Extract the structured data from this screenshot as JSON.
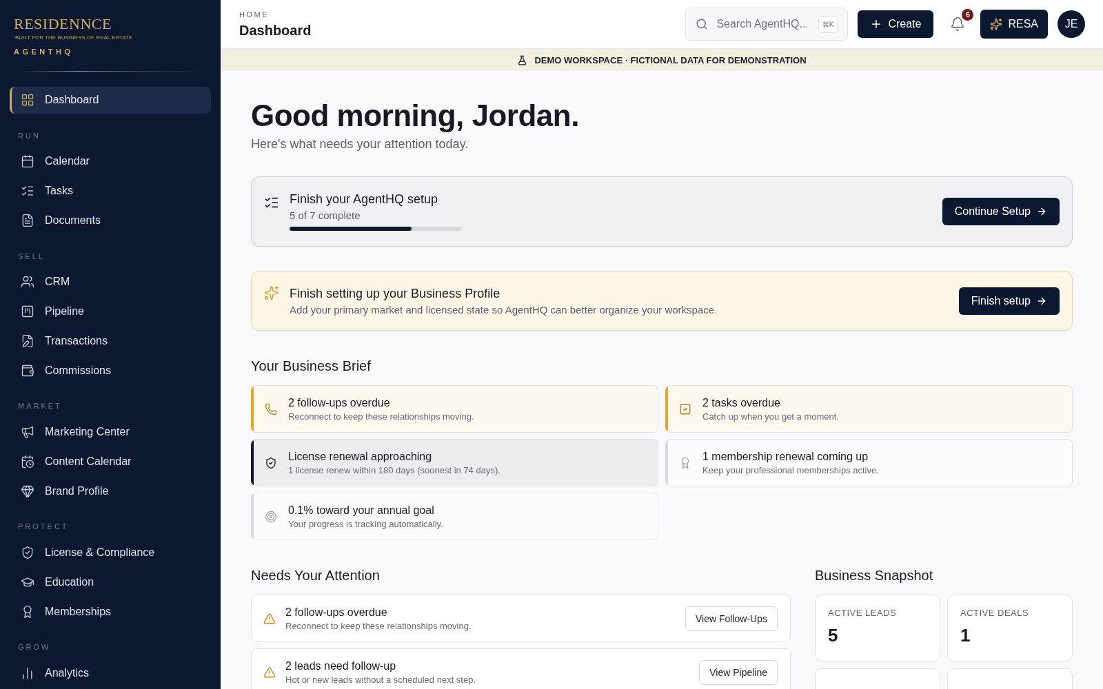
{
  "sidebar": {
    "logo": {
      "name": "RESIDENNCE",
      "tagline": "BUILT FOR THE BUSINESS OF REAL ESTATE",
      "product": "AGENTHQ"
    },
    "sections": [
      {
        "items": [
          {
            "label": "Dashboard",
            "kind": "grid",
            "selected": true
          }
        ]
      },
      {
        "title": "RUN",
        "items": [
          {
            "label": "Calendar",
            "kind": "calendar",
            "selected": false
          },
          {
            "label": "Tasks",
            "kind": "tasks",
            "selected": false
          },
          {
            "label": "Documents",
            "kind": "document",
            "selected": false
          }
        ]
      },
      {
        "title": "SELL",
        "items": [
          {
            "label": "CRM",
            "kind": "users",
            "selected": false
          },
          {
            "label": "Pipeline",
            "kind": "kanban",
            "selected": false
          },
          {
            "label": "Transactions",
            "kind": "file-pen",
            "selected": false
          },
          {
            "label": "Commissions",
            "kind": "wallet",
            "selected": false
          }
        ]
      },
      {
        "title": "MARKET",
        "items": [
          {
            "label": "Marketing Center",
            "kind": "megaphone",
            "selected": false
          },
          {
            "label": "Content Calendar",
            "kind": "calendar-clock",
            "selected": false
          },
          {
            "label": "Brand Profile",
            "kind": "gem",
            "selected": false
          }
        ]
      },
      {
        "title": "PROTECT",
        "items": [
          {
            "label": "License & Compliance",
            "kind": "shield",
            "selected": false
          },
          {
            "label": "Education",
            "kind": "cap",
            "selected": false
          },
          {
            "label": "Memberships",
            "kind": "award",
            "selected": false
          }
        ]
      },
      {
        "title": "GROW",
        "items": [
          {
            "label": "Analytics",
            "kind": "chart",
            "selected": false
          }
        ]
      }
    ]
  },
  "header": {
    "breadcrumb": "HOME",
    "title": "Dashboard",
    "search": {
      "placeholder": "Search AgentHQ...",
      "shortcut": "⌘K"
    },
    "create_button": "Create",
    "notifications": "6",
    "assistant_button": "RESA",
    "avatar": "JE"
  },
  "demo_banner": "DEMO WORKSPACE · FICTIONAL DATA FOR DEMONSTRATION",
  "greeting": {
    "title": "Good morning, Jordan.",
    "subtitle": "Here's what needs your attention today."
  },
  "setup_card": {
    "title": "Finish your AgentHQ setup",
    "progress_text": "5 of 7 complete",
    "level": 0.71,
    "button": "Continue Setup"
  },
  "profile_card": {
    "title": "Finish setting up your Business Profile",
    "text": "Add your primary market and licensed state so AgentHQ can better organize your workspace.",
    "button": "Finish setup"
  },
  "business_brief": {
    "title": "Your Business Brief",
    "cards": [
      {
        "color": "#e9a52a",
        "kind": "phone",
        "title": "2 follow-ups overdue",
        "text": "Reconnect to keep these relationships moving."
      },
      {
        "color": "#e9a52a",
        "kind": "check-square",
        "title": "2 tasks overdue",
        "text": "Catch up when you get a moment."
      },
      {
        "color": "#0c1830",
        "kind": "shield",
        "title": "License renewal approaching",
        "text": "1 license renew within 180 days (soonest in 74 days)."
      },
      {
        "color": "#d7dade",
        "kind": "award",
        "title": "1 membership renewal coming up",
        "text": "Keep your professional memberships active."
      },
      {
        "color": "#d7dade",
        "kind": "target",
        "title": "0.1% toward your annual goal",
        "text": "Your progress is tracking automatically."
      }
    ]
  },
  "needs_attention": {
    "title": "Needs Your Attention",
    "items": [
      {
        "title": "2 follow-ups overdue",
        "text": "Reconnect to keep these relationships moving.",
        "button": "View Follow-Ups"
      },
      {
        "title": "2 leads need follow-up",
        "text": "Hot or new leads without a scheduled next step.",
        "button": "View Pipeline"
      }
    ]
  },
  "business_snapshot": {
    "title": "Business Snapshot",
    "stats": [
      {
        "label": "ACTIVE LEADS",
        "value": "5"
      },
      {
        "label": "ACTIVE DEALS",
        "value": "1"
      }
    ]
  }
}
